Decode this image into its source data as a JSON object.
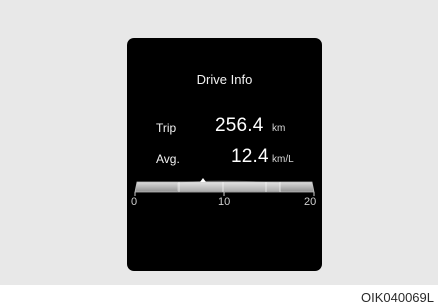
{
  "display": {
    "title": "Drive Info",
    "trip": {
      "label": "Trip",
      "value": "256.4",
      "unit": "km"
    },
    "average": {
      "label": "Avg.",
      "value": "12.4",
      "unit": "km/L"
    },
    "gauge": {
      "ticks": [
        "0",
        "10",
        "20"
      ],
      "range": [
        0,
        20
      ],
      "marker_value": 7.5
    }
  },
  "figure_code": "OIK040069L"
}
